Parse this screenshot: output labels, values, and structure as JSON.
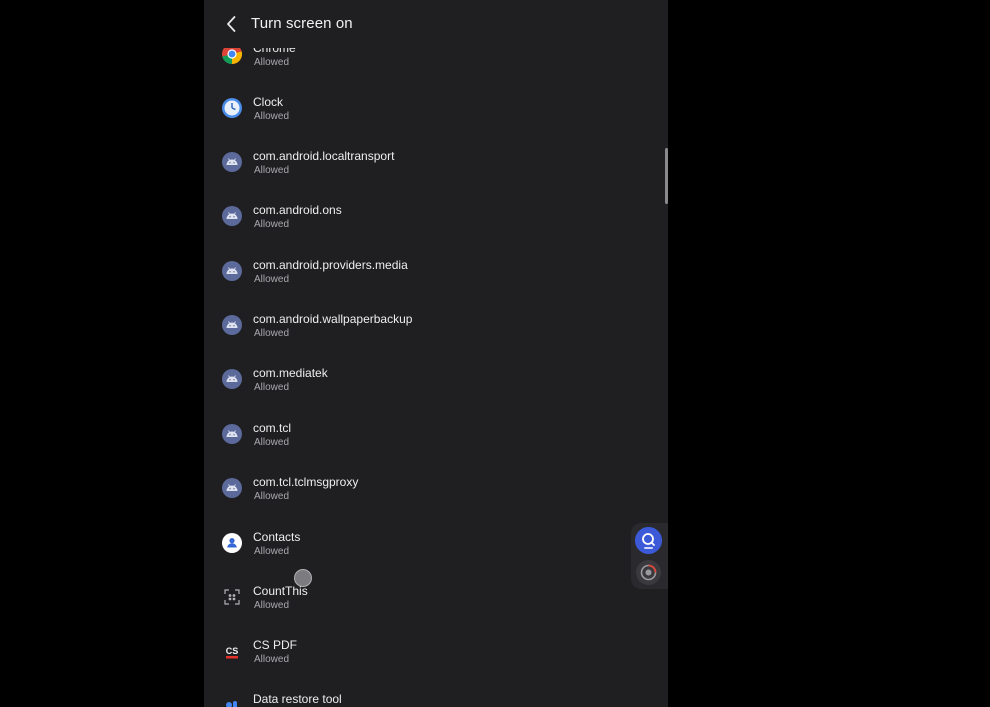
{
  "header": {
    "title": "Turn screen on",
    "back_icon": "arrow-back-icon"
  },
  "apps": [
    {
      "name": "Chrome",
      "status": "Allowed",
      "icon": "chrome-icon"
    },
    {
      "name": "Clock",
      "status": "Allowed",
      "icon": "clock-icon"
    },
    {
      "name": "com.android.localtransport",
      "status": "Allowed",
      "icon": "android-icon"
    },
    {
      "name": "com.android.ons",
      "status": "Allowed",
      "icon": "android-icon"
    },
    {
      "name": "com.android.providers.media",
      "status": "Allowed",
      "icon": "android-icon"
    },
    {
      "name": "com.android.wallpaperbackup",
      "status": "Allowed",
      "icon": "android-icon"
    },
    {
      "name": "com.mediatek",
      "status": "Allowed",
      "icon": "android-icon"
    },
    {
      "name": "com.tcl",
      "status": "Allowed",
      "icon": "android-icon"
    },
    {
      "name": "com.tcl.tclmsgproxy",
      "status": "Allowed",
      "icon": "android-icon"
    },
    {
      "name": "Contacts",
      "status": "Allowed",
      "icon": "contacts-icon"
    },
    {
      "name": "CountThis",
      "status": "Allowed",
      "icon": "countthis-icon"
    },
    {
      "name": "CS PDF",
      "status": "Allowed",
      "icon": "cs-pdf-icon"
    },
    {
      "name": "Data restore tool",
      "status": "",
      "icon": "data-restore-icon"
    }
  ],
  "floating": {
    "primary_icon": "screen-recorder-icon",
    "secondary_icon": "recorder-settings-icon"
  },
  "colors": {
    "background": "#1f1f22",
    "android_icon": "#5b6a9a",
    "accent": "#3c5ad8"
  }
}
